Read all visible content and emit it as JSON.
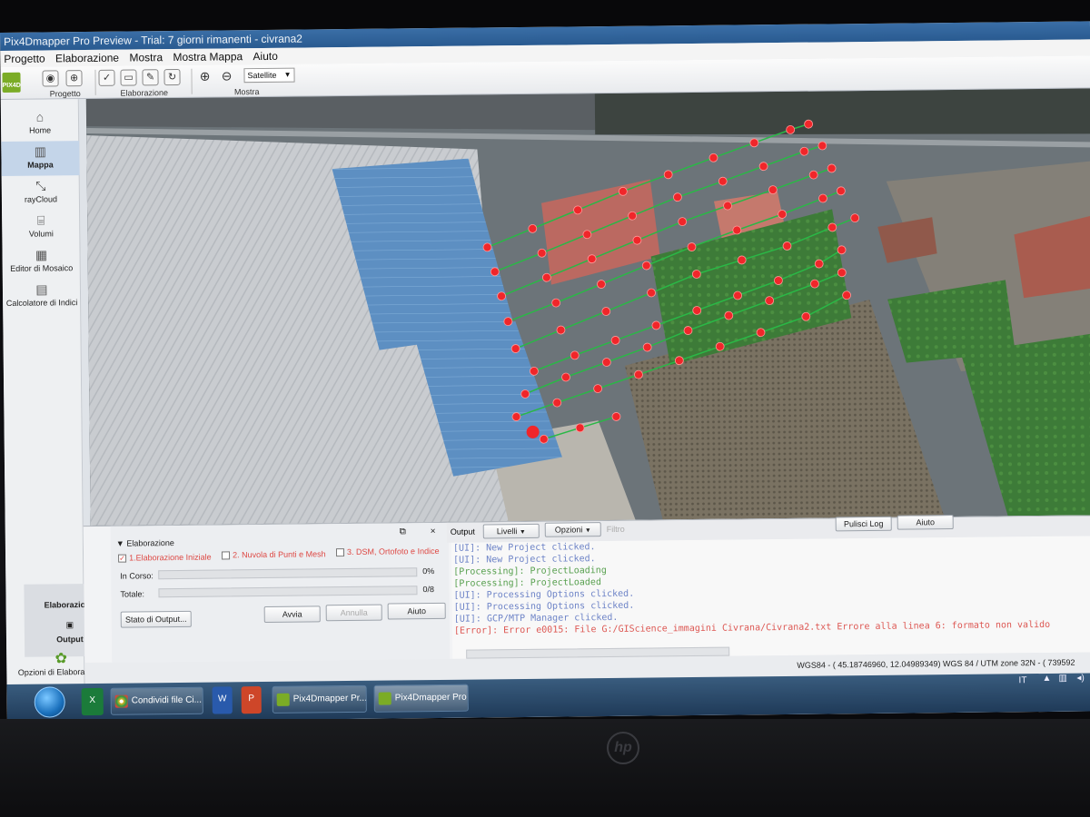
{
  "window": {
    "title": "Pix4Dmapper Pro Preview - Trial: 7 giorni rimanenti - civrana2"
  },
  "menu": [
    "Progetto",
    "Elaborazione",
    "Mostra",
    "Mostra Mappa",
    "Aiuto"
  ],
  "toolbar": {
    "groups": {
      "project": "Progetto",
      "processing": "Elaborazione",
      "view": "Mostra"
    },
    "basemap_select": "Satellite"
  },
  "sidebar": {
    "items": [
      {
        "label": "Home",
        "icon": "home-icon"
      },
      {
        "label": "Mappa",
        "icon": "map-icon"
      },
      {
        "label": "rayCloud",
        "icon": "raycloud-icon"
      },
      {
        "label": "Volumi",
        "icon": "cylinder-icon"
      },
      {
        "label": "Editor di Mosaico",
        "icon": "mosaic-icon"
      },
      {
        "label": "Calcolatore di Indici",
        "icon": "calculator-icon"
      }
    ],
    "bottom": {
      "processing": "Elaborazione",
      "output": "Output",
      "options": "Opzioni di Elaborazione"
    }
  },
  "processing_panel": {
    "header": "Elaborazione",
    "steps": [
      {
        "label": "1.Elaborazione Iniziale",
        "checked": true
      },
      {
        "label": "2. Nuvola di Punti e Mesh",
        "checked": false
      },
      {
        "label": "3. DSM, Ortofoto e Indice",
        "checked": false
      }
    ],
    "in_progress_label": "In Corso:",
    "in_progress_value": "0%",
    "total_label": "Totale:",
    "total_value": "0/8",
    "buttons": {
      "output_status": "Stato di Output...",
      "start": "Avvia",
      "cancel": "Annulla",
      "help": "Aiuto"
    }
  },
  "output_panel": {
    "title": "Output",
    "levels": "Livelli",
    "options": "Opzioni",
    "filter": "Filtro",
    "clear_log": "Pulisci Log",
    "help": "Aiuto",
    "log": [
      {
        "type": "ui",
        "text": "[UI]: New Project clicked."
      },
      {
        "type": "ui",
        "text": "[UI]: New Project clicked."
      },
      {
        "type": "proc",
        "text": "[Processing]: ProjectLoading"
      },
      {
        "type": "proc",
        "text": "[Processing]: ProjectLoaded"
      },
      {
        "type": "ui",
        "text": "[UI]: Processing Options clicked."
      },
      {
        "type": "ui",
        "text": "[UI]: Processing Options clicked."
      },
      {
        "type": "ui",
        "text": "[UI]: GCP/MTP Manager clicked."
      },
      {
        "type": "err",
        "text": "[Error]: Error e0015: File G:/GIScience_immagini Civrana/Civrana2.txt Errore alla linea 6: formato non valido"
      }
    ]
  },
  "statusbar": {
    "coords": "WGS84 - ( 45.18746960,   12.04989349)  WGS 84 / UTM zone 32N - (   739592"
  },
  "taskbar": {
    "tasks": [
      {
        "label": "Condividi file Ci...",
        "icon": "chrome-icon"
      },
      {
        "label": "Pix4Dmapper Pr...",
        "icon": "pix4d-icon"
      },
      {
        "label": "Pix4Dmapper Pro",
        "icon": "pix4d-icon"
      }
    ],
    "language": "IT"
  },
  "brand": {
    "hp": "hp"
  },
  "colors": {
    "accent": "#2b5a8d",
    "flight_point": "#e8282c",
    "flight_line": "#2fb64a",
    "error": "#d85a56"
  }
}
